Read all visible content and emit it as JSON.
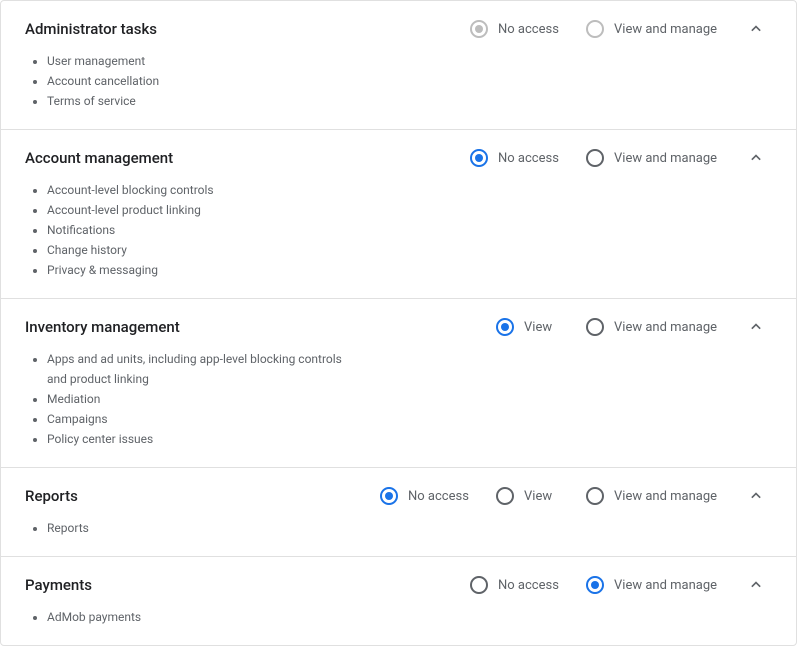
{
  "labels": {
    "no_access": "No access",
    "view": "View",
    "view_manage": "View and manage"
  },
  "sections": [
    {
      "id": "admin",
      "title": "Administrator tasks",
      "bullets": [
        "User management",
        "Account cancellation",
        "Terms of service"
      ],
      "options": [
        "no_access",
        "view_manage"
      ],
      "selected": "no_access",
      "disabled": true
    },
    {
      "id": "account",
      "title": "Account management",
      "bullets": [
        "Account-level blocking controls",
        "Account-level product linking",
        "Notifications",
        "Change history",
        "Privacy & messaging"
      ],
      "options": [
        "no_access",
        "view_manage"
      ],
      "selected": "no_access",
      "disabled": false
    },
    {
      "id": "inventory",
      "title": "Inventory management",
      "bullets": [
        "Apps and ad units, including app-level blocking controls and product linking",
        "Mediation",
        "Campaigns",
        "Policy center issues"
      ],
      "options": [
        "view",
        "view_manage"
      ],
      "selected": "view",
      "disabled": false
    },
    {
      "id": "reports",
      "title": "Reports",
      "bullets": [
        "Reports"
      ],
      "options": [
        "no_access",
        "view",
        "view_manage"
      ],
      "selected": "no_access",
      "disabled": false
    },
    {
      "id": "payments",
      "title": "Payments",
      "bullets": [
        "AdMob payments"
      ],
      "options": [
        "no_access",
        "view_manage"
      ],
      "selected": "view_manage",
      "disabled": false
    }
  ]
}
